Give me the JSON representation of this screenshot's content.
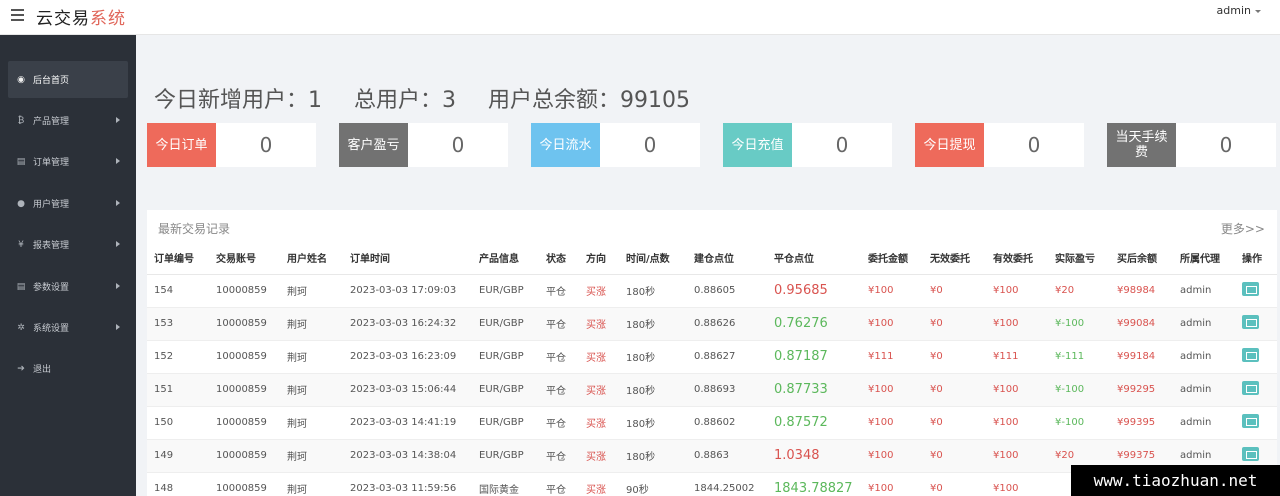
{
  "header": {
    "brand_main": "云交易",
    "brand_accent": "系统",
    "user": "admin"
  },
  "sidebar": {
    "items": [
      {
        "label": "后台首页",
        "icon": "dashboard-icon",
        "glyph": "◉"
      },
      {
        "label": "产品管理",
        "icon": "bitcoin-icon",
        "glyph": "₿"
      },
      {
        "label": "订单管理",
        "icon": "copy-icon",
        "glyph": "▤"
      },
      {
        "label": "用户管理",
        "icon": "user-icon",
        "glyph": "●"
      },
      {
        "label": "报表管理",
        "icon": "yen-icon",
        "glyph": "¥"
      },
      {
        "label": "参数设置",
        "icon": "copy-icon",
        "glyph": "▤"
      },
      {
        "label": "系统设置",
        "icon": "gears-icon",
        "glyph": "✲"
      },
      {
        "label": "退出",
        "icon": "signout-icon",
        "glyph": "➔"
      }
    ]
  },
  "stats": {
    "new_users": "今日新增用户：1",
    "total_users": "总用户：3",
    "total_balance": "用户总余额：99105"
  },
  "cards": [
    {
      "label": "今日订单",
      "value": "0",
      "color": "#ee6a5b"
    },
    {
      "label": "客户盈亏",
      "value": "0",
      "color": "#727272"
    },
    {
      "label": "今日流水",
      "value": "0",
      "color": "#6ec3ef"
    },
    {
      "label": "今日充值",
      "value": "0",
      "color": "#68cbc5"
    },
    {
      "label": "今日提现",
      "value": "0",
      "color": "#ee6a5b"
    },
    {
      "label": "当天手续费",
      "value": "0",
      "color": "#727272"
    }
  ],
  "records": {
    "title": "最新交易记录",
    "more": "更多>>",
    "columns": [
      "订单编号",
      "交易账号",
      "用户姓名",
      "订单时间",
      "产品信息",
      "状态",
      "方向",
      "时间/点数",
      "建仓点位",
      "平仓点位",
      "委托金额",
      "无效委托",
      "有效委托",
      "实际盈亏",
      "买后余额",
      "所属代理",
      "操作"
    ],
    "rows": [
      {
        "id": "154",
        "account": "10000859",
        "name": "荆珂",
        "time": "2023-03-03 17:09:03",
        "product": "EUR/GBP",
        "status": "平仓",
        "direction": "买涨",
        "duration": "180秒",
        "open": "0.88605",
        "close": "0.95685",
        "close_color": "red",
        "amount": "¥100",
        "invalid": "¥0",
        "valid": "¥100",
        "pnl": "¥20",
        "pnl_color": "red",
        "balance": "¥98984",
        "agent": "admin"
      },
      {
        "id": "153",
        "account": "10000859",
        "name": "荆珂",
        "time": "2023-03-03 16:24:32",
        "product": "EUR/GBP",
        "status": "平仓",
        "direction": "买涨",
        "duration": "180秒",
        "open": "0.88626",
        "close": "0.76276",
        "close_color": "green",
        "amount": "¥100",
        "invalid": "¥0",
        "valid": "¥100",
        "pnl": "¥-100",
        "pnl_color": "green",
        "balance": "¥99084",
        "agent": "admin"
      },
      {
        "id": "152",
        "account": "10000859",
        "name": "荆珂",
        "time": "2023-03-03 16:23:09",
        "product": "EUR/GBP",
        "status": "平仓",
        "direction": "买涨",
        "duration": "180秒",
        "open": "0.88627",
        "close": "0.87187",
        "close_color": "green",
        "amount": "¥111",
        "invalid": "¥0",
        "valid": "¥111",
        "pnl": "¥-111",
        "pnl_color": "green",
        "balance": "¥99184",
        "agent": "admin"
      },
      {
        "id": "151",
        "account": "10000859",
        "name": "荆珂",
        "time": "2023-03-03 15:06:44",
        "product": "EUR/GBP",
        "status": "平仓",
        "direction": "买涨",
        "duration": "180秒",
        "open": "0.88693",
        "close": "0.87733",
        "close_color": "green",
        "amount": "¥100",
        "invalid": "¥0",
        "valid": "¥100",
        "pnl": "¥-100",
        "pnl_color": "green",
        "balance": "¥99295",
        "agent": "admin"
      },
      {
        "id": "150",
        "account": "10000859",
        "name": "荆珂",
        "time": "2023-03-03 14:41:19",
        "product": "EUR/GBP",
        "status": "平仓",
        "direction": "买涨",
        "duration": "180秒",
        "open": "0.88602",
        "close": "0.87572",
        "close_color": "green",
        "amount": "¥100",
        "invalid": "¥0",
        "valid": "¥100",
        "pnl": "¥-100",
        "pnl_color": "green",
        "balance": "¥99395",
        "agent": "admin"
      },
      {
        "id": "149",
        "account": "10000859",
        "name": "荆珂",
        "time": "2023-03-03 14:38:04",
        "product": "EUR/GBP",
        "status": "平仓",
        "direction": "买涨",
        "duration": "180秒",
        "open": "0.8863",
        "close": "1.0348",
        "close_color": "red",
        "amount": "¥100",
        "invalid": "¥0",
        "valid": "¥100",
        "pnl": "¥20",
        "pnl_color": "red",
        "balance": "¥99375",
        "agent": "admin"
      },
      {
        "id": "148",
        "account": "10000859",
        "name": "荆珂",
        "time": "2023-03-03 11:59:56",
        "product": "国际黄金",
        "status": "平仓",
        "direction": "买涨",
        "duration": "90秒",
        "open": "1844.25002",
        "close": "1843.78827",
        "close_color": "green",
        "amount": "¥100",
        "invalid": "¥0",
        "valid": "¥100",
        "pnl": "",
        "pnl_color": "green",
        "balance": "",
        "agent": ""
      }
    ]
  },
  "watermark": "www.tiaozhuan.net"
}
